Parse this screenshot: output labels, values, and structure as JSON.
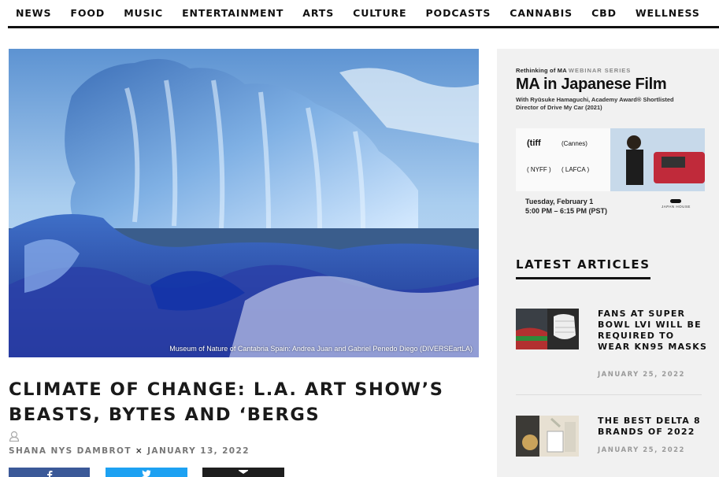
{
  "nav": {
    "items": [
      "NEWS",
      "FOOD",
      "MUSIC",
      "ENTERTAINMENT",
      "ARTS",
      "CULTURE",
      "PODCASTS",
      "CANNABIS",
      "CBD",
      "WELLNESS"
    ]
  },
  "hero": {
    "caption": "Museum of Nature of Cantabria Spain: Andrea Juan and Gabriel Penedo Diego (DIVERSEartLA)"
  },
  "article": {
    "headline": "CLIMATE OF CHANGE: L.A. ART SHOW’S BEASTS, BYTES AND ‘BERGS",
    "author": "SHANA NYS DAMBROT",
    "separator": "×",
    "date": "JANUARY 13, 2022"
  },
  "share": {
    "facebook_icon": "facebook-icon",
    "twitter_icon": "twitter-icon",
    "email_icon": "email-icon"
  },
  "sidebar": {
    "ad": {
      "kicker": "Rethinking of MA",
      "kicker_soft": "WEBINAR SERIES",
      "title": "MA in Japanese Film",
      "sub_line1": "With Ryūsuke Hamaguchi, Academy Award® Shortlisted",
      "sub_line2": "Director of Drive My Car (2021)",
      "date_line1": "Tuesday, February 1",
      "date_line2": "5:00 PM – 6:15 PM (PST)",
      "logo_text": "JAPAN HOUSE"
    },
    "latest_heading": "LATEST ARTICLES",
    "articles": [
      {
        "title": "FANS AT SUPER BOWL LVI WILL BE REQUIRED TO WEAR KN95 MASKS",
        "date": "JANUARY 25, 2022"
      },
      {
        "title": "THE BEST DELTA 8 BRANDS OF 2022",
        "date": "JANUARY 25, 2022"
      }
    ]
  },
  "colors": {
    "facebook": "#3b5998",
    "twitter": "#1da1f2",
    "email": "#1e1e1e",
    "sidebar_bg": "#f1f1f1"
  }
}
